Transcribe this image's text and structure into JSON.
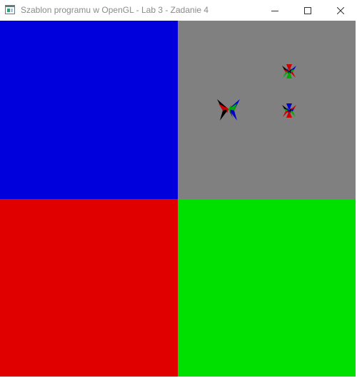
{
  "window": {
    "title": "Szablon programu w OpenGL - Lab 3 - Zadanie 4",
    "icons": {
      "app": "opengl-window-icon",
      "minimize": "minimize-icon",
      "maximize": "maximize-icon",
      "close": "close-icon"
    }
  },
  "viewport": {
    "quadrants": {
      "top_left": "#0000dc",
      "top_right": "#808080",
      "bottom_left": "#e00000",
      "bottom_right": "#00e000"
    },
    "sprites": [
      {
        "name": "butterfly-sprite"
      },
      {
        "name": "small-sprite"
      },
      {
        "name": "small-sprite"
      }
    ]
  }
}
